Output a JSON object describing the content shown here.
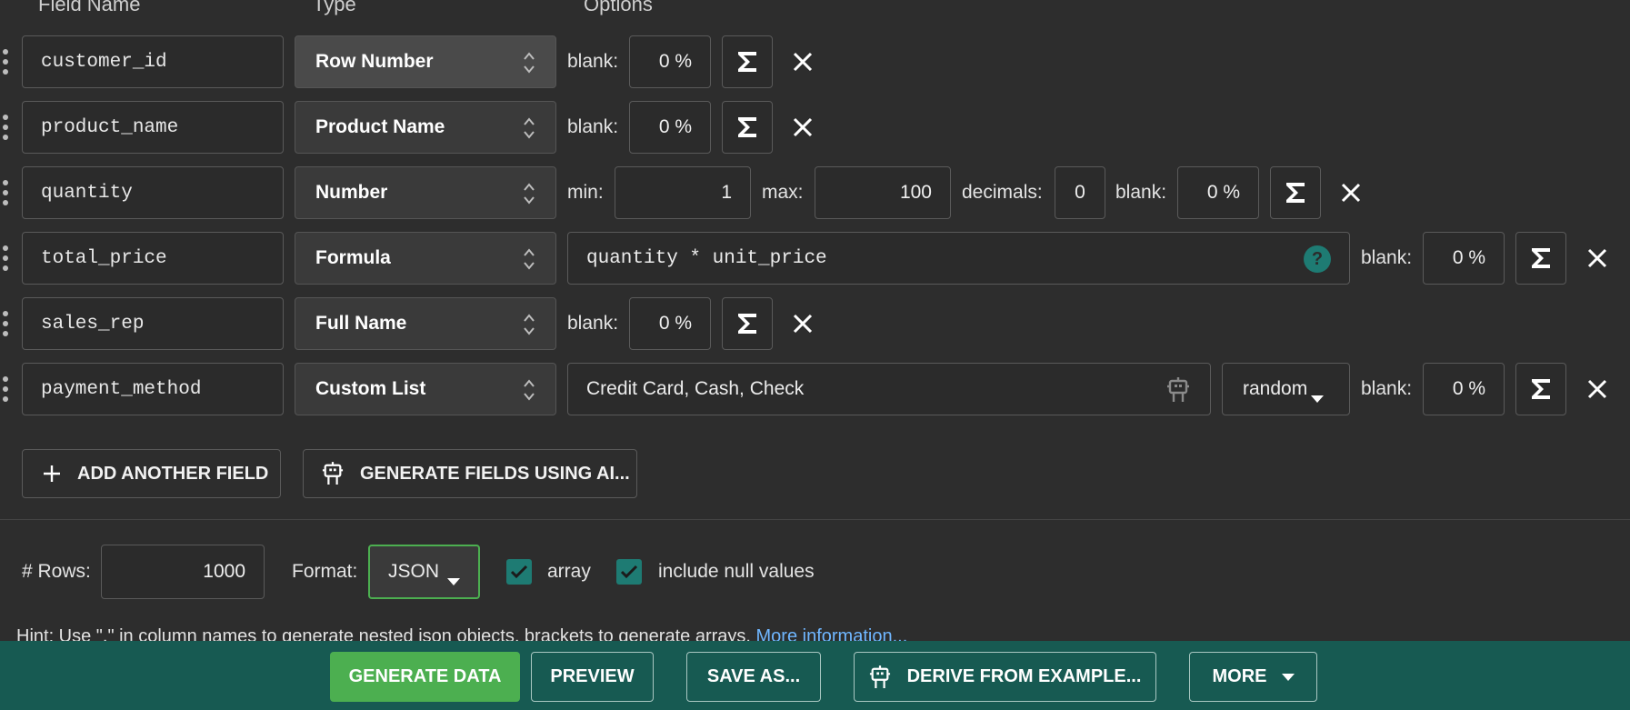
{
  "headers": {
    "field_name": "Field Name",
    "type": "Type",
    "options": "Options"
  },
  "fields": [
    {
      "name": "customer_id",
      "type": "Row Number",
      "blank_label": "blank:",
      "blank": "0 %"
    },
    {
      "name": "product_name",
      "type": "Product Name",
      "blank_label": "blank:",
      "blank": "0 %"
    },
    {
      "name": "quantity",
      "type": "Number",
      "min_label": "min:",
      "min": "1",
      "max_label": "max:",
      "max": "100",
      "decimals_label": "decimals:",
      "decimals": "0",
      "blank_label": "blank:",
      "blank": "0 %"
    },
    {
      "name": "total_price",
      "type": "Formula",
      "formula": "quantity * unit_price",
      "blank_label": "blank:",
      "blank": "0 %"
    },
    {
      "name": "sales_rep",
      "type": "Full Name",
      "blank_label": "blank:",
      "blank": "0 %"
    },
    {
      "name": "payment_method",
      "type": "Custom List",
      "values": "Credit Card, Cash, Check",
      "order": "random",
      "blank_label": "blank:",
      "blank": "0 %"
    }
  ],
  "actions": {
    "add_field": "ADD ANOTHER FIELD",
    "generate_ai": "GENERATE FIELDS USING AI..."
  },
  "settings": {
    "rows_label": "# Rows:",
    "rows": "1000",
    "format_label": "Format:",
    "format": "JSON",
    "array_label": "array",
    "array_checked": true,
    "null_label": "include null values",
    "null_checked": true
  },
  "hint": {
    "text": "Hint: Use \".\" in column names to generate nested json objects, brackets to generate arrays.",
    "link": "More information..."
  },
  "footer": {
    "generate": "GENERATE DATA",
    "preview": "PREVIEW",
    "save_as": "SAVE AS...",
    "derive": "DERIVE FROM EXAMPLE...",
    "more": "MORE"
  },
  "colors": {
    "accent": "#1e7b73",
    "primary_button": "#4caf50",
    "footer_bg": "#175a52",
    "link": "#6fb6ff"
  }
}
